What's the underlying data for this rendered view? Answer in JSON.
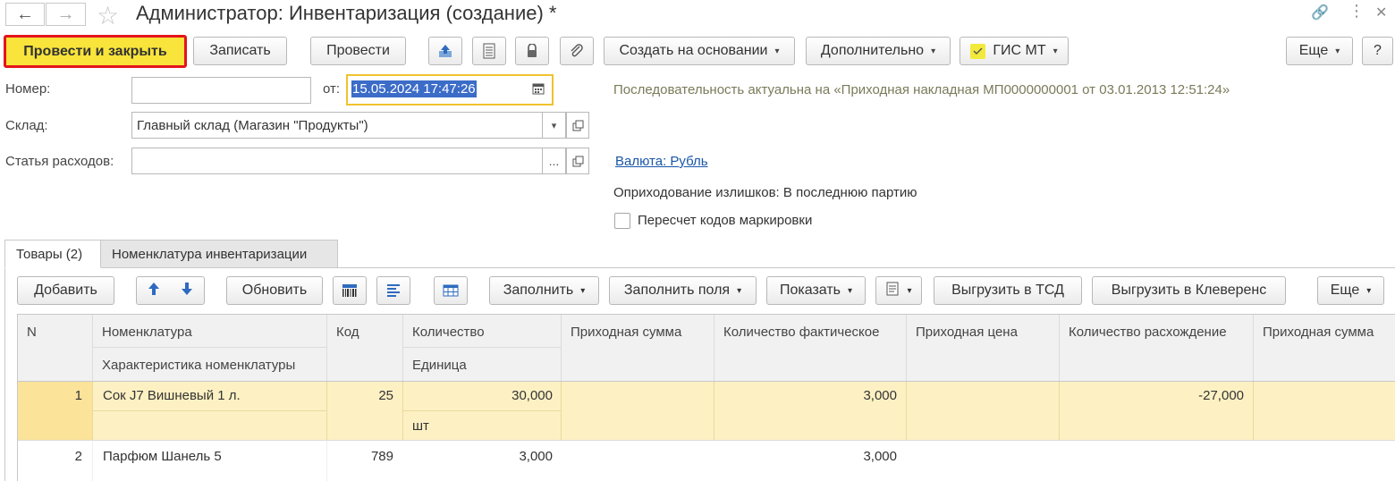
{
  "window": {
    "title": "Администратор: Инвентаризация (создание) *"
  },
  "toolbar": {
    "post_close": "Провести и закрыть",
    "save": "Записать",
    "post": "Провести",
    "create_based_on": "Создать на основании",
    "additional": "Дополнительно",
    "gis_mt": "ГИС МТ",
    "more": "Еще",
    "help": "?"
  },
  "form": {
    "number_label": "Номер:",
    "number_value": "",
    "date_label": "от:",
    "date_value": "15.05.2024 17:47:26",
    "sequence_info": "Последовательность актуальна на «Приходная накладная МП0000000001 от 03.01.2013 12:51:24»",
    "warehouse_label": "Склад:",
    "warehouse_value": "Главный склад (Магазин \"Продукты\")",
    "expense_label": "Статья расходов:",
    "expense_value": "",
    "currency_link": "Валюта: Рубль",
    "surplus_text": "Оприходование излишков: В последнюю партию",
    "recount_label": "Пересчет кодов маркировки"
  },
  "tabs": [
    {
      "label": "Товары (2)"
    },
    {
      "label": "Номенклатура инвентаризации"
    }
  ],
  "table_toolbar": {
    "add": "Добавить",
    "refresh": "Обновить",
    "fill": "Заполнить",
    "fill_fields": "Заполнить поля",
    "show": "Показать",
    "export_tsd": "Выгрузить в ТСД",
    "export_cleverence": "Выгрузить в Клеверенс",
    "more": "Еще"
  },
  "table": {
    "headers": {
      "n": "N",
      "nomenclature": "Номенклатура",
      "characteristic": "Характеристика номенклатуры",
      "code": "Код",
      "quantity": "Количество",
      "unit": "Единица",
      "incoming_sum": "Приходная сумма",
      "actual_qty": "Количество фактическое",
      "incoming_price": "Приходная цена",
      "qty_diff": "Количество расхождение",
      "incoming_sum2": "Приходная сумма"
    },
    "rows": [
      {
        "n": "1",
        "nomenclature": "Сок J7 Вишневый 1 л.",
        "characteristic": "",
        "code": "25",
        "quantity": "30,000",
        "unit": "шт",
        "incoming_sum": "",
        "actual_qty": "3,000",
        "incoming_price": "",
        "qty_diff": "-27,000"
      },
      {
        "n": "2",
        "nomenclature": "Парфюм Шанель 5",
        "characteristic": "",
        "code": "789",
        "quantity": "3,000",
        "unit": "",
        "incoming_sum": "",
        "actual_qty": "3,000",
        "incoming_price": "",
        "qty_diff": ""
      }
    ]
  },
  "colors": {
    "primary_button": "#f8e43a",
    "primary_border": "#e4141b",
    "selected_row": "#fdf1c3",
    "selected_n_cell": "#fbe39a",
    "date_focus_border": "#f0c22e",
    "date_selection": "#3b6cc7",
    "link": "#1a56a8"
  }
}
